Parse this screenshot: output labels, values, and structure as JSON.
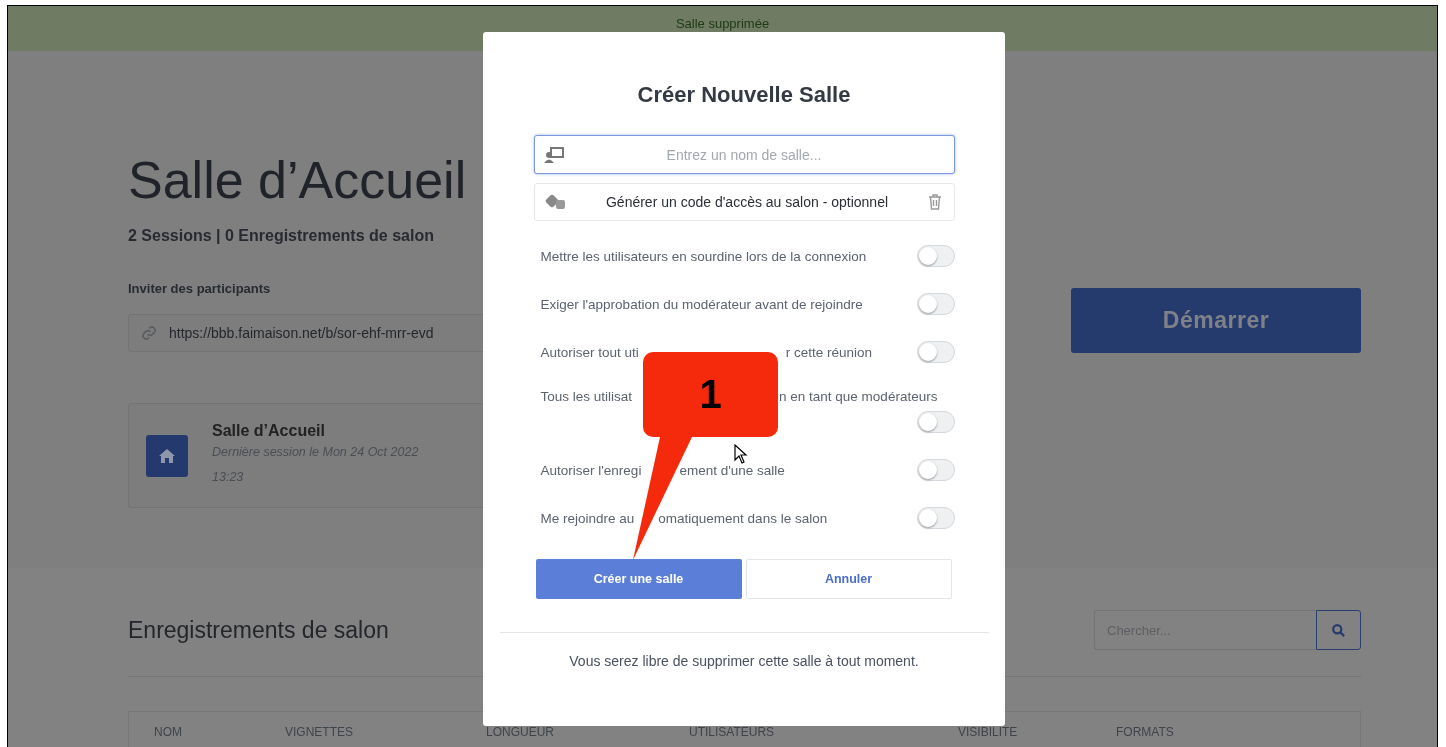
{
  "banner": {
    "text": "Salle supprimée"
  },
  "room": {
    "title": "Salle d’Accueil",
    "stats": "2 Sessions | 0 Enregistrements de salon",
    "invite_label": "Inviter des participants",
    "invite_url": "https://bbb.faimaison.net/b/sor-ehf-mrr-evd",
    "start_button": "Démarrer"
  },
  "room_card": {
    "name": "Salle d’Accueil",
    "last_session": "Dernière session le Mon 24 Oct 2022 13:23"
  },
  "recordings": {
    "title": "Enregistrements de salon",
    "search_placeholder": "Chercher...",
    "columns": [
      "NOM",
      "VIGNETTES",
      "LONGUEUR",
      "UTILISATEURS",
      "VISIBILITE",
      "FORMATS"
    ]
  },
  "modal": {
    "title": "Créer Nouvelle Salle",
    "name_placeholder": "Entrez un nom de salle...",
    "access_code": "Générer un code d'accès au salon - optionnel",
    "options": [
      {
        "parts": [
          "Mettre les utilisateurs en sourdine lors de la connexion"
        ],
        "on": false
      },
      {
        "parts": [
          "Exiger l'approbation du modérateur avant de rejoindre"
        ],
        "on": false
      },
      {
        "parts": [
          "Autoriser tout uti",
          "r cette réunion"
        ],
        "on": false
      },
      {
        "parts": [
          "Tous les utilisat",
          "n en tant que modérateurs"
        ],
        "on": false
      },
      {
        "parts": [
          "Autoriser l'enregi",
          "ement d'une salle"
        ],
        "on": false
      },
      {
        "parts": [
          "Me rejoindre au",
          "omatiquement dans le salon"
        ],
        "on": false
      }
    ],
    "create_button": "Créer une salle",
    "cancel_button": "Annuler",
    "footer": "Vous serez libre de supprimer cette salle à tout moment."
  },
  "callout": {
    "label": "1"
  }
}
